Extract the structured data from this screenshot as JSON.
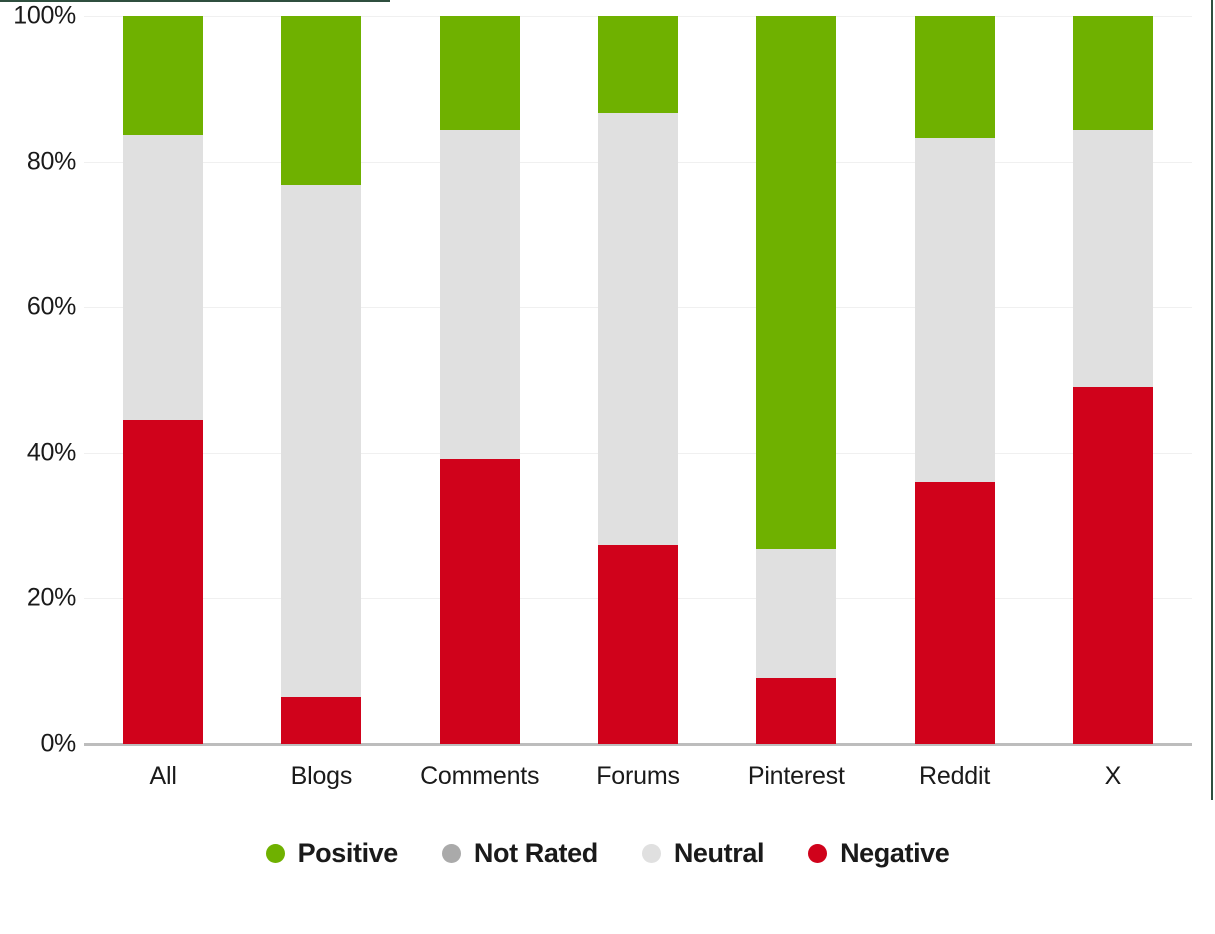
{
  "chart_data": {
    "type": "bar",
    "subtype": "stacked-100-percent",
    "title": "",
    "xlabel": "",
    "ylabel": "",
    "categories": [
      "All",
      "Blogs",
      "Comments",
      "Forums",
      "Pinterest",
      "Reddit",
      "X"
    ],
    "series": [
      {
        "name": "Negative",
        "color": "#D0021B",
        "values": [
          44.5,
          6.5,
          39.1,
          27.3,
          9.1,
          36.0,
          49.0
        ]
      },
      {
        "name": "Neutral",
        "color": "#E0E0E0",
        "values": [
          39.2,
          70.3,
          45.2,
          59.4,
          17.7,
          47.2,
          35.3
        ]
      },
      {
        "name": "Not Rated",
        "color": "#AAAAAA",
        "values": [
          0,
          0,
          0,
          0,
          0,
          0,
          0
        ]
      },
      {
        "name": "Positive",
        "color": "#6FB100",
        "values": [
          16.3,
          23.2,
          15.7,
          13.3,
          73.2,
          16.8,
          15.7
        ]
      }
    ],
    "stack_order": [
      "Negative",
      "Neutral",
      "Not Rated",
      "Positive"
    ],
    "ylim": [
      0,
      100
    ],
    "yticks": [
      0,
      20,
      40,
      60,
      80,
      100
    ],
    "ytick_labels": [
      "0%",
      "20%",
      "40%",
      "60%",
      "80%",
      "100%"
    ],
    "grid": true,
    "grid_axis": "y",
    "legend_position": "bottom"
  },
  "axes": {
    "y": {
      "ticks": [
        {
          "value": 100,
          "label": "100%"
        },
        {
          "value": 80,
          "label": "80%"
        },
        {
          "value": 60,
          "label": "60%"
        },
        {
          "value": 40,
          "label": "40%"
        },
        {
          "value": 20,
          "label": "20%"
        },
        {
          "value": 0,
          "label": "0%"
        }
      ]
    },
    "x": {
      "ticks": [
        {
          "label": "All"
        },
        {
          "label": "Blogs"
        },
        {
          "label": "Comments"
        },
        {
          "label": "Forums"
        },
        {
          "label": "Pinterest"
        },
        {
          "label": "Reddit"
        },
        {
          "label": "X"
        }
      ]
    }
  },
  "legend": {
    "items": [
      {
        "label": "Positive",
        "color": "#6FB100"
      },
      {
        "label": "Not Rated",
        "color": "#AAAAAA"
      },
      {
        "label": "Neutral",
        "color": "#E0E0E0"
      },
      {
        "label": "Negative",
        "color": "#D0021B"
      }
    ]
  },
  "colors": {
    "positive": "#6FB100",
    "not_rated": "#AAAAAA",
    "neutral": "#E0E0E0",
    "negative": "#D0021B",
    "gridline": "#F0F0F0",
    "baseline": "#BDBDBD",
    "border": "#2F4F3F",
    "text": "#1A1A1A",
    "background": "#FFFFFF"
  }
}
